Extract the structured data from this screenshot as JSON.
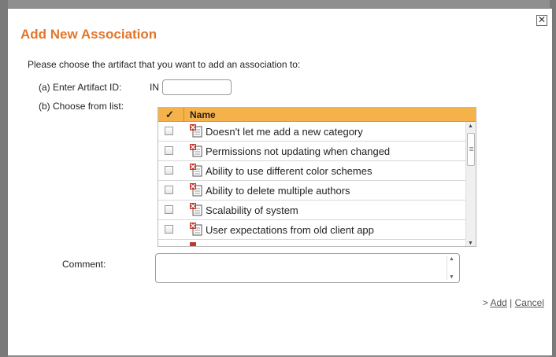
{
  "dialog": {
    "title": "Add New Association",
    "close_glyph": "✕",
    "instruction": "Please choose the artifact that you want to add an association to:",
    "option_a_label": "(a)  Enter Artifact ID:",
    "artifact_prefix": "IN",
    "artifact_id_value": "",
    "option_b_label": "(b)  Choose from list:",
    "list": {
      "header_check": "✓",
      "header_name": "Name",
      "items": [
        {
          "label": "Doesn't let me add a new category",
          "checked": false,
          "icon": "incident-icon"
        },
        {
          "label": "Permissions not updating when changed",
          "checked": false,
          "icon": "incident-icon"
        },
        {
          "label": "Ability to use different color schemes",
          "checked": false,
          "icon": "incident-icon"
        },
        {
          "label": "Ability to delete multiple authors",
          "checked": false,
          "icon": "incident-icon"
        },
        {
          "label": "Scalability of system",
          "checked": false,
          "icon": "incident-icon"
        },
        {
          "label": "User expectations from old client app",
          "checked": false,
          "icon": "incident-icon"
        }
      ]
    },
    "comment_label": "Comment:",
    "comment_value": "",
    "actions": {
      "prefix": ">",
      "add_label": "Add",
      "separator": "|",
      "cancel_label": "Cancel"
    }
  },
  "colors": {
    "title": "#e2762b",
    "list_header": "#f6b24a"
  }
}
